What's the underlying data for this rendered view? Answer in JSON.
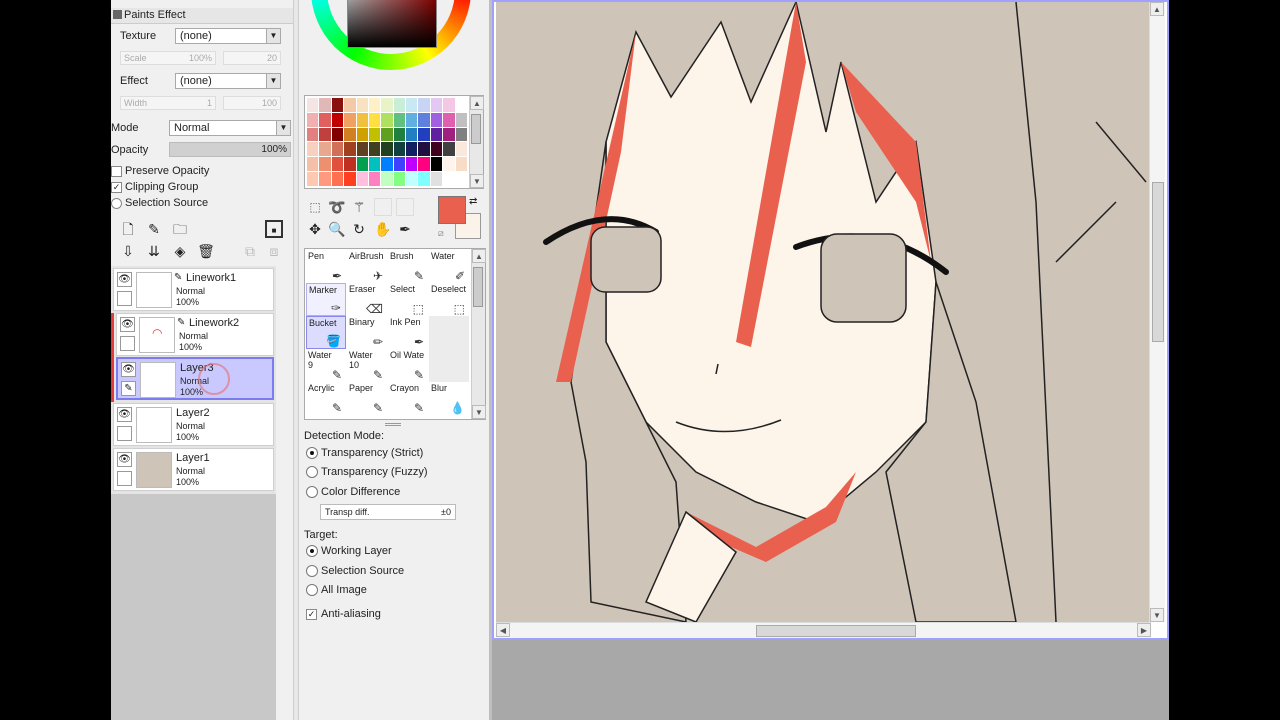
{
  "paint_effect": {
    "header": "Paints Effect",
    "texture_label": "Texture",
    "texture_value": "(none)",
    "scale_label": "Scale",
    "scale_value": "100%",
    "scale_num": "20",
    "effect_label": "Effect",
    "effect_value": "(none)",
    "width_label": "Width",
    "width_value": "1",
    "width_num": "100"
  },
  "layer_props": {
    "mode_label": "Mode",
    "mode_value": "Normal",
    "opacity_label": "Opacity",
    "opacity_value": "100%",
    "preserve_opacity": "Preserve Opacity",
    "clipping_group": "Clipping Group",
    "selection_source": "Selection Source"
  },
  "layers": [
    {
      "name": "Linework1",
      "mode": "Normal",
      "opacity": "100%"
    },
    {
      "name": "Linework2",
      "mode": "Normal",
      "opacity": "100%"
    },
    {
      "name": "Layer3",
      "mode": "Normal",
      "opacity": "100%"
    },
    {
      "name": "Layer2",
      "mode": "Normal",
      "opacity": "100%"
    },
    {
      "name": "Layer1",
      "mode": "Normal",
      "opacity": "100%"
    }
  ],
  "brushes": [
    {
      "name": "Pen",
      "sub": ""
    },
    {
      "name": "AirBrush",
      "sub": ""
    },
    {
      "name": "Brush",
      "sub": ""
    },
    {
      "name": "Water",
      "sub": ""
    },
    {
      "name": "Marker",
      "sub": ""
    },
    {
      "name": "Eraser",
      "sub": ""
    },
    {
      "name": "Select",
      "sub": ""
    },
    {
      "name": "Deselect",
      "sub": ""
    },
    {
      "name": "Bucket",
      "sub": ""
    },
    {
      "name": "Binary",
      "sub": ""
    },
    {
      "name": "Ink Pen",
      "sub": ""
    },
    {
      "name": "",
      "sub": ""
    },
    {
      "name": "Water",
      "sub": "9"
    },
    {
      "name": "Water",
      "sub": "10"
    },
    {
      "name": "Oil Wate",
      "sub": ""
    },
    {
      "name": "",
      "sub": ""
    },
    {
      "name": "Acrylic",
      "sub": ""
    },
    {
      "name": "Paper",
      "sub": ""
    },
    {
      "name": "Crayon",
      "sub": ""
    },
    {
      "name": "Blur",
      "sub": ""
    }
  ],
  "bucket_props": {
    "detection_label": "Detection Mode:",
    "det_strict": "Transparency (Strict)",
    "det_fuzzy": "Transparency (Fuzzy)",
    "det_color": "Color Difference",
    "transp_diff_label": "Transp diff.",
    "transp_diff_value": "±0",
    "target_label": "Target:",
    "tgt_working": "Working Layer",
    "tgt_selection": "Selection Source",
    "tgt_all": "All Image",
    "antialias": "Anti-aliasing"
  },
  "colors": {
    "foreground": "#e9614e",
    "background": "#fbf3ea",
    "layer_highlight": "#c9c9ff",
    "canvas_border": "#a0a0ff"
  },
  "palette": [
    "#f4e4e4",
    "#e0b8b8",
    "#8a1010",
    "#f3c9a8",
    "#f7e3c2",
    "#fff0c8",
    "#e9f3c8",
    "#c8eed8",
    "#c8e8f4",
    "#c8d4f4",
    "#e4c8f4",
    "#f4c8e4",
    "#ffffff",
    "#f0b0b0",
    "#e06060",
    "#c00000",
    "#f0a060",
    "#f0c040",
    "#ffe040",
    "#b0e060",
    "#60c080",
    "#60b0e0",
    "#6080e0",
    "#a060e0",
    "#e060b0",
    "#c0c0c0",
    "#e08080",
    "#c04040",
    "#800000",
    "#d08020",
    "#d0a000",
    "#c0c000",
    "#60a020",
    "#208040",
    "#2080c0",
    "#2040c0",
    "#6020a0",
    "#a02080",
    "#808080",
    "#f8d0c0",
    "#e8a890",
    "#d07058",
    "#a04020",
    "#604020",
    "#404020",
    "#204020",
    "#104040",
    "#102060",
    "#201040",
    "#400020",
    "#404040",
    "#fbe8dc",
    "#f4c0a8",
    "#ec9070",
    "#e0503c",
    "#c03020",
    "#00a050",
    "#00c0c0",
    "#0080ff",
    "#4040ff",
    "#c000ff",
    "#ff0080",
    "#000000",
    "#fff4ec",
    "#f8dcc8",
    "#ffc8b0",
    "#ff9a80",
    "#ff7050",
    "#ff4020",
    "#ffc0e0",
    "#ff80c0",
    "#c0ffc0",
    "#80ff80",
    "#c0ffff",
    "#80ffff",
    "#e0e0e0"
  ]
}
